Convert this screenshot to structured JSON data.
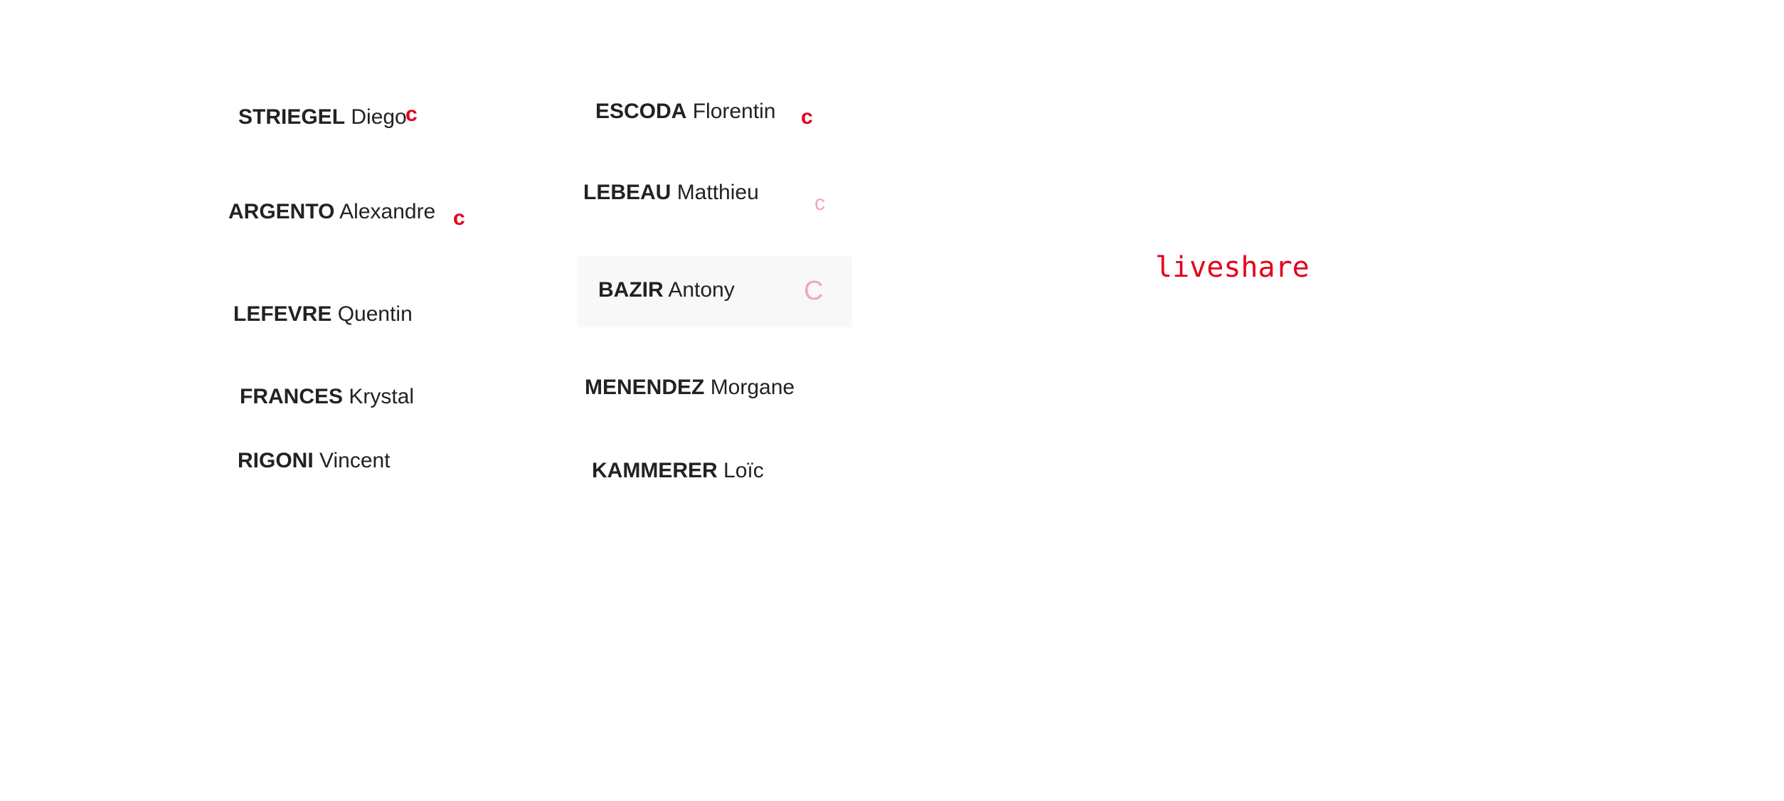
{
  "people": [
    {
      "last": "STRIEGEL",
      "first": "Diego",
      "mark": "c"
    },
    {
      "last": "ARGENTO",
      "first": "Alexandre",
      "mark": "c"
    },
    {
      "last": "LEFEVRE",
      "first": "Quentin"
    },
    {
      "last": "FRANCES",
      "first": "Krystal"
    },
    {
      "last": "RIGONI",
      "first": "Vincent"
    },
    {
      "last": "ESCODA",
      "first": "Florentin",
      "mark": "c"
    },
    {
      "last": "LEBEAU",
      "first": "Matthieu",
      "mark": "c"
    },
    {
      "last": "BAZIR",
      "first": "Antony",
      "mark": "C"
    },
    {
      "last": "MENENDEZ",
      "first": "Morgane"
    },
    {
      "last": "KAMMERER",
      "first": "Loïc"
    }
  ],
  "liveshare_text": "liveshare",
  "colors": {
    "accent_red": "#e3001b",
    "faint_pink": "#f4a6b6",
    "text": "#222222",
    "hover_bg": "#f8f8f8"
  }
}
